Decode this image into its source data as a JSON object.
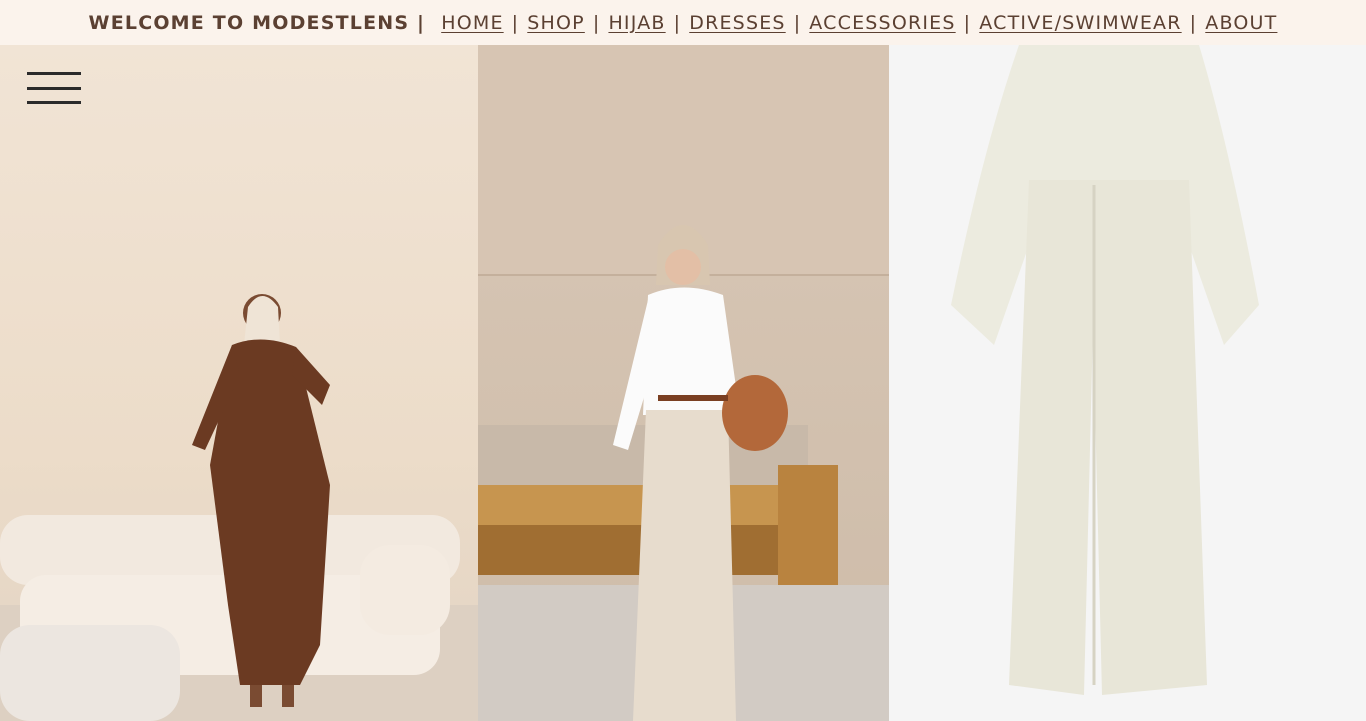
{
  "header": {
    "welcome": "WELCOME TO MODESTLENS |",
    "nav": [
      {
        "label": "HOME"
      },
      {
        "label": "SHOP"
      },
      {
        "label": "HIJAB"
      },
      {
        "label": "DRESSES"
      },
      {
        "label": "ACCESSORIES"
      },
      {
        "label": "ACTIVE/SWIMWEAR"
      },
      {
        "label": "ABOUT"
      }
    ]
  },
  "menu": {
    "icon": "hamburger-menu-icon"
  },
  "hero": {
    "images": [
      {
        "alt": "Woman in brown wrap dress standing by cream sofa"
      },
      {
        "alt": "Woman in white shirt and beige skirt by wooden bench"
      },
      {
        "alt": "Cream cape jumpsuit product photo"
      }
    ]
  },
  "colors": {
    "topbar_bg": "#fbf3ec",
    "nav_text": "#5b4032"
  }
}
